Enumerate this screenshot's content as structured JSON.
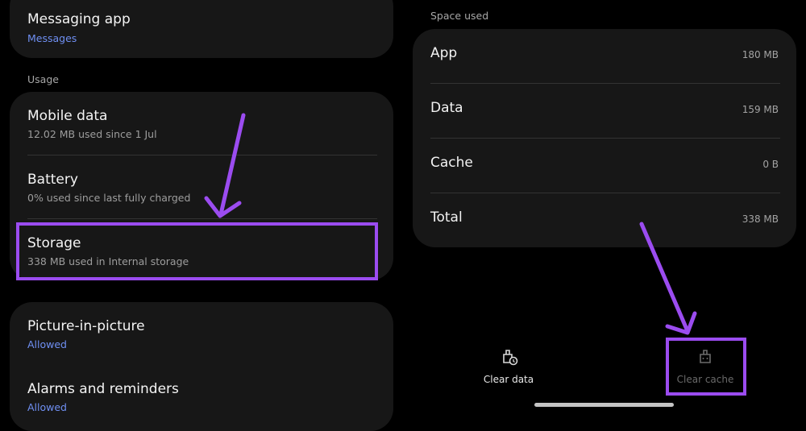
{
  "left": {
    "messaging": {
      "title": "Messaging app",
      "value": "Messages"
    },
    "usage_label": "Usage",
    "usage_items": [
      {
        "title": "Mobile data",
        "subtitle": "12.02 MB used since 1 Jul"
      },
      {
        "title": "Battery",
        "subtitle": "0% used since last fully charged"
      },
      {
        "title": "Storage",
        "subtitle": "338 MB used in Internal storage"
      }
    ],
    "permissions": [
      {
        "title": "Picture-in-picture",
        "value": "Allowed"
      },
      {
        "title": "Alarms and reminders",
        "value": "Allowed"
      }
    ]
  },
  "right": {
    "space_used_label": "Space used",
    "rows": [
      {
        "label": "App",
        "value": "180 MB"
      },
      {
        "label": "Data",
        "value": "159 MB"
      },
      {
        "label": "Cache",
        "value": "0 B"
      },
      {
        "label": "Total",
        "value": "338 MB"
      }
    ],
    "actions": {
      "clear_data": "Clear data",
      "clear_cache": "Clear cache"
    }
  },
  "colors": {
    "annotation": "#9b4cf0",
    "link": "#6f8ff2",
    "card": "#171717"
  }
}
